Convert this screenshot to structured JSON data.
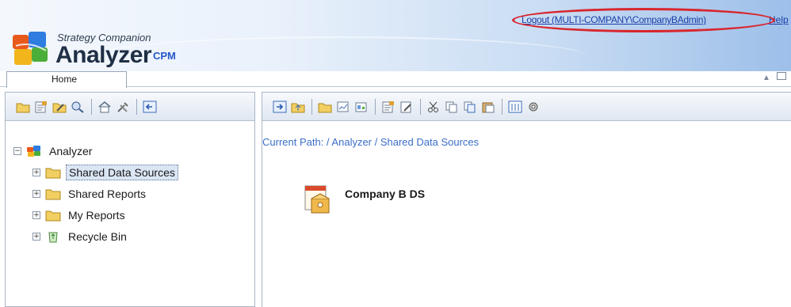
{
  "header": {
    "brand_small": "Strategy Companion",
    "brand_big": "Analyzer",
    "brand_suffix": "CPM",
    "logout_link": "Logout (MULTI-COMPANY\\CompanyBAdmin)",
    "help_link": "Help",
    "highlight_color": "#d8262d"
  },
  "tabs": [
    {
      "label": "Home",
      "active": true
    }
  ],
  "tab_controls": {
    "pin_icon": "pin-icon",
    "restore_icon": "restore-icon"
  },
  "left_toolbar": {
    "icons": [
      "new-folder-icon",
      "properties-icon",
      "edit-icon",
      "find-icon",
      "home-icon",
      "tools-icon",
      "back-icon"
    ]
  },
  "tree": {
    "root": {
      "label": "Analyzer",
      "expanded": true,
      "icon": "analyzer-icon"
    },
    "children": [
      {
        "label": "Shared Data Sources",
        "icon": "folder-icon",
        "selected": true
      },
      {
        "label": "Shared Reports",
        "icon": "folder-icon",
        "selected": false
      },
      {
        "label": "My Reports",
        "icon": "folder-icon",
        "selected": false
      },
      {
        "label": "Recycle Bin",
        "icon": "recycle-bin-icon",
        "selected": false
      }
    ]
  },
  "right_toolbar": {
    "icons": [
      "navigate-icon",
      "up-folder-icon",
      "new-folder-icon",
      "new-report-icon",
      "new-ds-icon",
      "properties-icon",
      "edit-icon",
      "cut-icon",
      "copy-icon",
      "copy-to-icon",
      "paste-icon",
      "view-icon",
      "settings-icon"
    ]
  },
  "content": {
    "current_path": "Current Path: / Analyzer / Shared Data Sources",
    "items": [
      {
        "label": "Company B DS",
        "icon": "data-source-icon"
      }
    ]
  }
}
